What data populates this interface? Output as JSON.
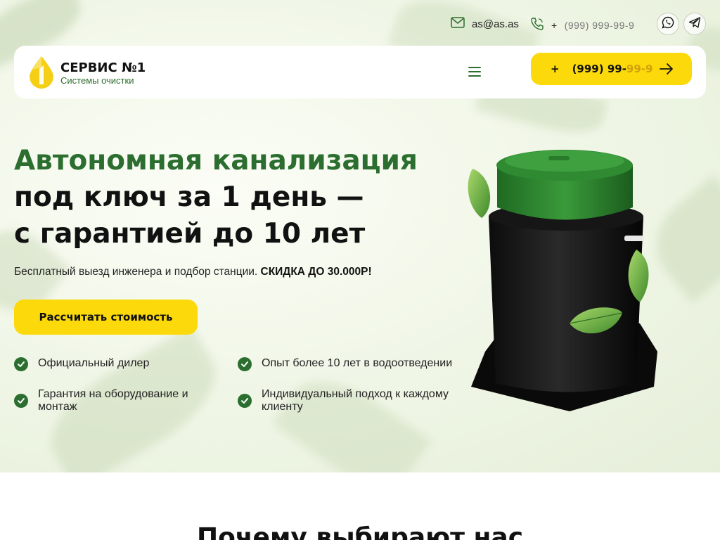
{
  "topbar": {
    "email": "as@as.as",
    "phone_prefix": "+",
    "phone_main": "(999) 999-99-9",
    "phone_fade": "",
    "icons": [
      "mail-icon",
      "phone-icon",
      "whatsapp-icon",
      "telegram-icon"
    ]
  },
  "header": {
    "logo_title": "СЕРВИС №1",
    "logo_subtitle": "Системы очистки",
    "menu_icon": "menu-icon",
    "cta_prefix": "+",
    "cta_phone_main": "(999) 99-",
    "cta_phone_fade": "99-9",
    "cta_icon": "arrow-right-icon"
  },
  "hero": {
    "title_green": "Автономная канализация",
    "title_line2": "под ключ за 1 день —",
    "title_line3": "с гарантией до 10 лет",
    "subtitle_text": "Бесплатный выезд инженера и подбор станции. ",
    "subtitle_bold": "СКИДКА ДО 30.000Р!",
    "cta_label": "Рассчитать стоимость",
    "features": [
      "Официальный дилер",
      "Опыт более 10 лет в водоотведении",
      "Гарантия на оборудование и монтаж",
      "Индивидуальный подход к каждому клиенту"
    ]
  },
  "section": {
    "title": "Почему выбирают нас"
  },
  "colors": {
    "accent_yellow": "#fbd90a",
    "brand_green": "#2b6e2f",
    "background": "#f4f8ee"
  }
}
